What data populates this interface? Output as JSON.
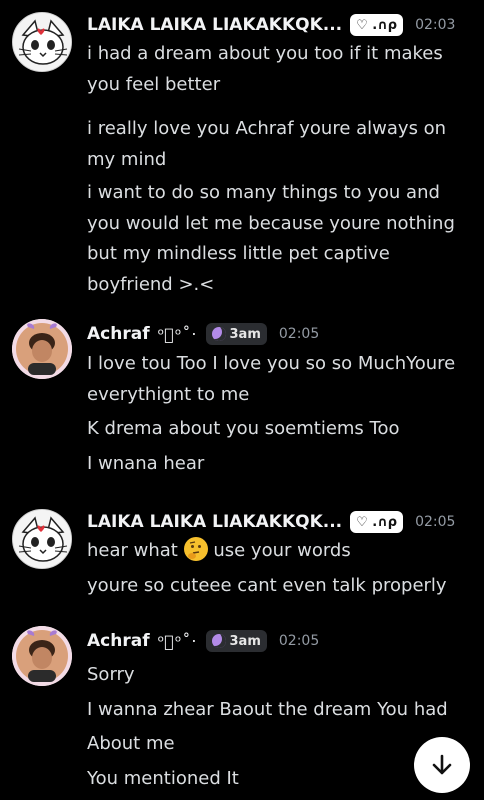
{
  "messages": [
    {
      "author": "LAIKA LAIKA LIAKAKKQK...",
      "badge": "♡ .∩ρ",
      "time": "02:03",
      "lines": [
        "i had a dream about you too if it makes you feel better",
        "i really love you Achraf youre always on my mind",
        "i want to do so many things to you and you would let me because youre nothing but my mindless little pet captive boyfriend >.<"
      ]
    },
    {
      "author": "Achraf",
      "symbols": "ᵒᷟᵒ˚‧",
      "badge": "3am",
      "time": "02:05",
      "lines": [
        "I love tou Too I love you so so MuchYoure everythignt to me",
        "K drema about you soemtiems Too",
        "I wnana hear"
      ]
    },
    {
      "author": "LAIKA LAIKA LIAKAKKQK...",
      "badge": "♡ .∩ρ",
      "time": "02:05",
      "lines": [
        "hear what",
        "use your words",
        "youre so cuteee cant even talk properly"
      ]
    },
    {
      "author": "Achraf",
      "symbols": "ᵒᷟᵒ˚‧",
      "badge": "3am",
      "time": "02:05",
      "lines": [
        "Sorry",
        "I wanna zhear Baout the dream You had",
        "About me",
        "You mentioned It"
      ]
    }
  ],
  "icons": {
    "thinking_emoji": "thinking-face-icon",
    "scroll_down": "arrow-down-icon",
    "badge_heart": "heart-icon",
    "badge_moon": "moon-icon"
  },
  "colors": {
    "background": "#000000",
    "text": "#dbdee1",
    "timestamp": "#949ba4",
    "author": "#f2f3f5"
  }
}
